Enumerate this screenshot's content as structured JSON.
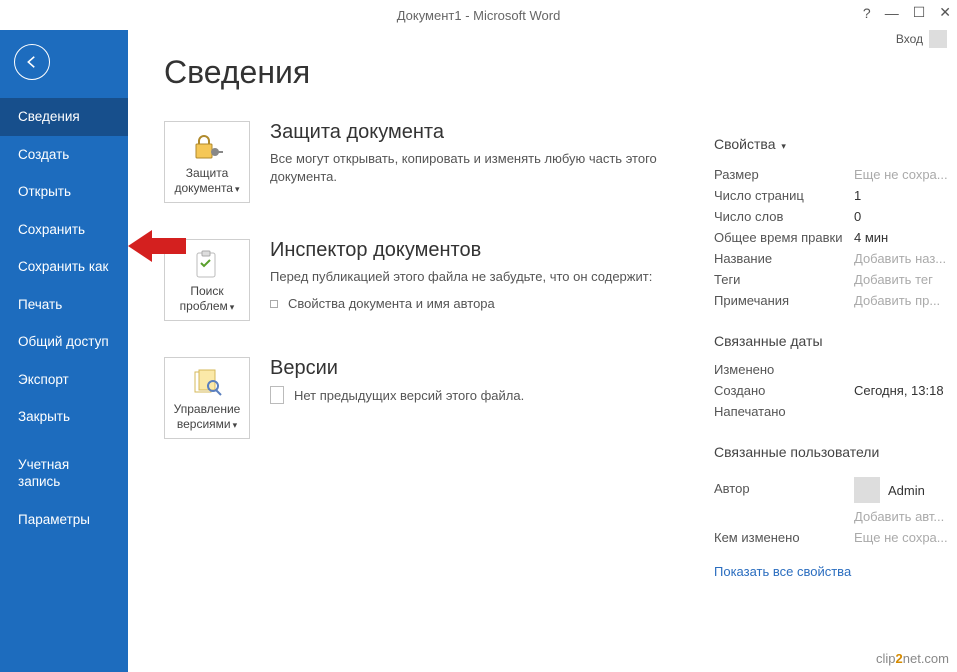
{
  "titlebar": {
    "title": "Документ1 - Microsoft Word",
    "signin": "Вход"
  },
  "sidebar": {
    "items": [
      {
        "label": "Сведения",
        "active": true
      },
      {
        "label": "Создать"
      },
      {
        "label": "Открыть"
      },
      {
        "label": "Сохранить"
      },
      {
        "label": "Сохранить как"
      },
      {
        "label": "Печать"
      },
      {
        "label": "Общий доступ"
      },
      {
        "label": "Экспорт"
      },
      {
        "label": "Закрыть"
      }
    ],
    "footer_items": [
      {
        "label": "Учетная запись"
      },
      {
        "label": "Параметры"
      }
    ]
  },
  "page": {
    "title": "Сведения"
  },
  "protect": {
    "tile_label": "Защита документа",
    "title": "Защита документа",
    "desc": "Все могут открывать, копировать и изменять любую часть этого документа."
  },
  "inspect": {
    "tile_label": "Поиск проблем",
    "title": "Инспектор документов",
    "desc": "Перед публикацией этого файла не забудьте, что он содержит:",
    "bullet1": "Свойства документа и имя автора"
  },
  "versions": {
    "tile_label": "Управление версиями",
    "title": "Версии",
    "none": "Нет предыдущих версий этого файла."
  },
  "props": {
    "header": "Свойства",
    "size_label": "Размер",
    "size_value": "Еще не сохра...",
    "pages_label": "Число страниц",
    "pages_value": "1",
    "words_label": "Число слов",
    "words_value": "0",
    "time_label": "Общее время правки",
    "time_value": "4 мин",
    "title_label": "Название",
    "title_value": "Добавить наз...",
    "tags_label": "Теги",
    "tags_value": "Добавить тег",
    "comments_label": "Примечания",
    "comments_value": "Добавить пр..."
  },
  "dates": {
    "header": "Связанные даты",
    "modified_label": "Изменено",
    "modified_value": "",
    "created_label": "Создано",
    "created_value": "Сегодня, 13:18",
    "printed_label": "Напечатано",
    "printed_value": ""
  },
  "people": {
    "header": "Связанные пользователи",
    "author_label": "Автор",
    "author_name": "Admin",
    "add_author": "Добавить авт...",
    "lastmod_label": "Кем изменено",
    "lastmod_value": "Еще не сохра..."
  },
  "show_all": "Показать все свойства",
  "watermark": {
    "prefix": "clip",
    "num": "2",
    "suffix": "net.com"
  }
}
